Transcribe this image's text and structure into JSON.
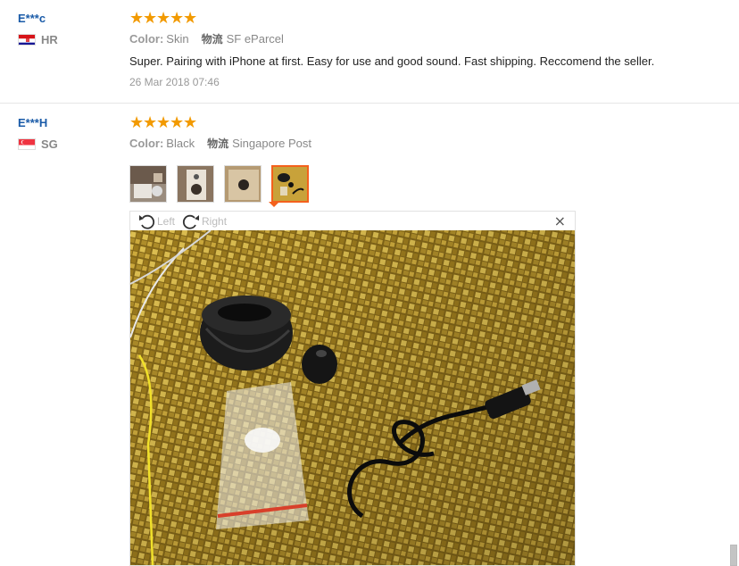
{
  "reviews": [
    {
      "user": "E***c",
      "country": "HR",
      "rating": 5,
      "stars": [
        "★",
        "★",
        "★",
        "★",
        "★"
      ],
      "color_label": "Color:",
      "color_value": "Skin",
      "logistics_label": "物流",
      "logistics_value": "SF eParcel",
      "text": "Super. Pairing with iPhone at first. Easy for use and good sound. Fast shipping. Reccomend the seller.",
      "date": "26 Mar 2018 07:46"
    },
    {
      "user": "E***H",
      "country": "SG",
      "rating": 5,
      "stars": [
        "★",
        "★",
        "★",
        "★",
        "★"
      ],
      "color_label": "Color:",
      "color_value": "Black",
      "logistics_label": "物流",
      "logistics_value": "Singapore Post",
      "thumbnails": [
        "photo-thumbnail-1",
        "photo-thumbnail-2",
        "photo-thumbnail-3",
        "photo-thumbnail-4"
      ],
      "active_thumbnail": 4
    }
  ],
  "viewer": {
    "rotate_left_label": "Left",
    "rotate_right_label": "Right",
    "close_glyph": "×"
  },
  "icons": {
    "star": "star-icon",
    "rotate_left": "rotate-left-icon",
    "rotate_right": "rotate-right-icon",
    "close": "close-icon"
  },
  "colors": {
    "star": "#f29a00",
    "username": "#1a5ba8",
    "active_border": "#f4611d"
  }
}
